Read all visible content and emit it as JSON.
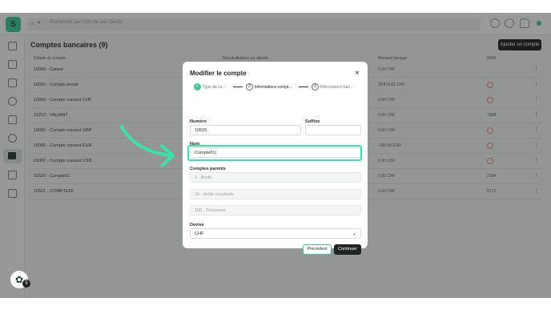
{
  "app": {
    "logo": "S"
  },
  "search": {
    "placeholder": "Recherche par nom de vos clients"
  },
  "page": {
    "title": "Comptes bancaires (9)",
    "add_button": "Ajouter un compte",
    "columns": [
      "Détails du compte",
      "Réconciliations en attente",
      "Montant banque",
      "IBAN"
    ]
  },
  "accounts": [
    {
      "label": "10000 - Caisse",
      "amount": "0.00 CHF",
      "iban": "",
      "flag": false
    },
    {
      "label": "10000 - Compte postal",
      "amount": "30'870.01 CHF",
      "iban": "",
      "flag": true
    },
    {
      "label": "10000 - Compte courant CHF",
      "amount": "0.00 CHF",
      "iban": "",
      "flag": true
    },
    {
      "label": "10210 - VALIANT",
      "amount": "0.00 CHF",
      "iban": "7908",
      "flag": false
    },
    {
      "label": "10000 - Compte courant GBP",
      "amount": "0.00 CHF",
      "iban": "",
      "flag": true
    },
    {
      "label": "10000 - Compte courant EUR",
      "amount": "-100.00 EUR",
      "iban": "",
      "flag": true
    },
    {
      "label": "10000 - Compte courant USD",
      "amount": "0.00 USD",
      "iban": "",
      "flag": true
    },
    {
      "label": "10520 - Compte01",
      "amount": "0.00 CHF",
      "iban": "2334",
      "flag": false
    },
    {
      "label": "10521 - COMPTE02",
      "amount": "0.00 CHF",
      "iban": "5712",
      "flag": false
    }
  ],
  "modal": {
    "title": "Modifier le compte",
    "close": "×",
    "steps": [
      {
        "num": "✓",
        "label": "Type de co…"
      },
      {
        "num": "2",
        "label": "Informations compt…"
      },
      {
        "num": "3",
        "label": "Informations ban…"
      }
    ],
    "fields": {
      "numero": {
        "label": "Numéro",
        "value": "10520"
      },
      "suffixe": {
        "label": "Suffixe",
        "value": ""
      },
      "nom": {
        "label": "Nom",
        "value": "Compte01|"
      },
      "parents": {
        "label": "Comptes parents",
        "values": [
          "1 - Actifs",
          "10 - Actifs circulants",
          "100 - Trésorerie"
        ]
      },
      "devise": {
        "label": "Devise",
        "value": "CHF"
      }
    },
    "buttons": {
      "previous": "Précédent",
      "continue": "Continuer"
    }
  },
  "help": {
    "badge": "5"
  },
  "colors": {
    "accent": "#3fc79a",
    "highlight": "#3be0aa",
    "dark": "#1f2525"
  }
}
